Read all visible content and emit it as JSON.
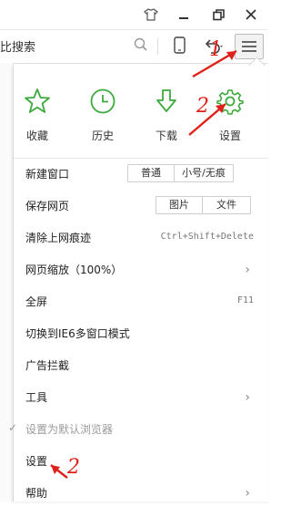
{
  "titlebar": {
    "icons": [
      "shirt-icon",
      "minimize-icon",
      "restore-icon",
      "close-icon"
    ]
  },
  "toolbar": {
    "search_text": "比搜索",
    "icons": [
      "search-icon",
      "phone-icon",
      "undo-icon",
      "hamburger-menu-icon"
    ]
  },
  "quick_actions": [
    {
      "label": "收藏",
      "icon": "star-icon"
    },
    {
      "label": "历史",
      "icon": "clock-icon"
    },
    {
      "label": "下载",
      "icon": "download-arrow-icon"
    },
    {
      "label": "设置",
      "icon": "gear-icon"
    }
  ],
  "menu": {
    "new_window": {
      "label": "新建窗口",
      "options": [
        "普通",
        "小号/无痕"
      ]
    },
    "save_page": {
      "label": "保存网页",
      "options": [
        "图片",
        "文件"
      ]
    },
    "clear_traces": {
      "label": "清除上网痕迹",
      "shortcut": "Ctrl+Shift+Delete"
    },
    "zoom": {
      "label": "网页缩放（100%）"
    },
    "fullscreen": {
      "label": "全屏",
      "shortcut": "F11"
    },
    "ie6_mode": {
      "label": "切换到IE6多窗口模式"
    },
    "adblock": {
      "label": "广告拦截"
    },
    "tools": {
      "label": "工具"
    },
    "default_browser": {
      "label": "设置为默认浏览器"
    },
    "settings": {
      "label": "设置"
    },
    "help": {
      "label": "帮助"
    }
  },
  "annotations": [
    "1",
    "2",
    "2"
  ],
  "colors": {
    "accent_green": "#3daa3d",
    "annotation_red": "#e0201a"
  }
}
